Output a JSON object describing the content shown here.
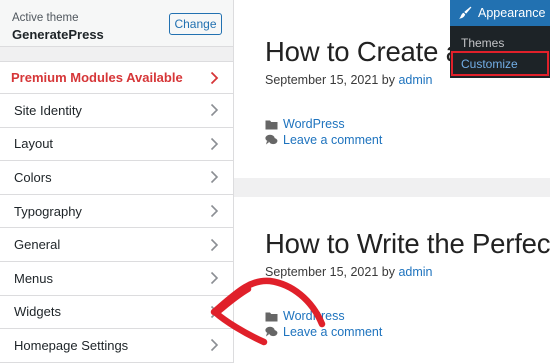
{
  "sidebar": {
    "active_theme_label": "Active theme",
    "theme_name": "GeneratePress",
    "change_button_label": "Change",
    "premium_label": "Premium Modules Available",
    "panels": [
      {
        "label": "Site Identity"
      },
      {
        "label": "Layout"
      },
      {
        "label": "Colors"
      },
      {
        "label": "Typography"
      },
      {
        "label": "General"
      },
      {
        "label": "Menus"
      },
      {
        "label": "Widgets"
      },
      {
        "label": "Homepage Settings"
      }
    ]
  },
  "posts": [
    {
      "title": "How to Create a",
      "date": "September 15, 2021",
      "by": "by",
      "author": "admin",
      "category": "WordPress",
      "comment_link": "Leave a comment"
    },
    {
      "title": "How to Write the Perfect",
      "date": "September 15, 2021",
      "by": "by",
      "author": "admin",
      "category": "WordPress",
      "comment_link": "Leave a comment"
    }
  ],
  "admin_menu": {
    "header": "Appearance",
    "items": [
      "Themes",
      "Customize"
    ]
  },
  "colors": {
    "accent_blue": "#2271b1",
    "premium_red": "#d63638",
    "annotation_red": "#e0202a",
    "link_blue": "#1e73be"
  },
  "icons": [
    "chevron-right-icon",
    "folder-icon",
    "comment-icon",
    "paintbrush-icon"
  ]
}
